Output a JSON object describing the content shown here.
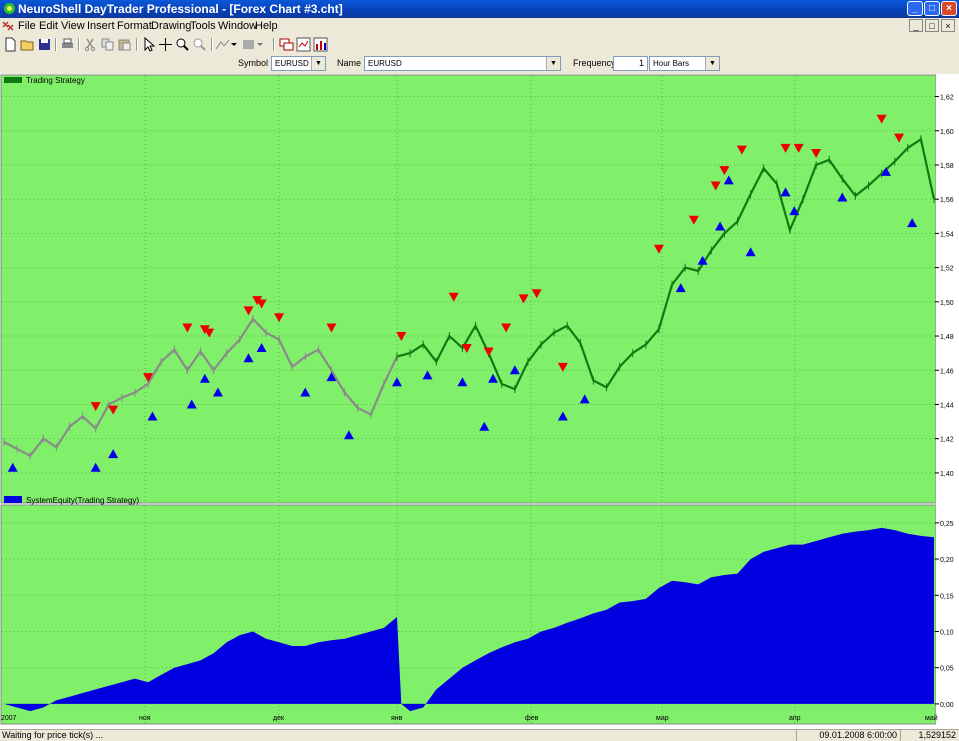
{
  "window": {
    "title": "NeuroShell DayTrader Professional - [Forex Chart #3.cht]",
    "buttons": [
      "_",
      "□",
      "×"
    ]
  },
  "menu": {
    "items": [
      "File",
      "Edit",
      "View",
      "Insert",
      "Format",
      "Drawing",
      "Tools",
      "Window",
      "Help"
    ]
  },
  "toolbar": {
    "icons": [
      "new-icon",
      "open-icon",
      "save-icon",
      "print-icon",
      "cut-icon",
      "copy-icon",
      "paste-icon",
      "pointer-icon",
      "crosshair-icon",
      "zoom-in-icon",
      "zoom-out-icon",
      "line-tool-icon",
      "color-tool-icon",
      "windows-icon",
      "indicator-icon",
      "chart-icon"
    ]
  },
  "symbol_bar": {
    "symbol_label": "Symbol",
    "symbol_value": "EURUSD",
    "name_label": "Name",
    "name_value": "EURUSD",
    "frequency_label": "Frequency",
    "frequency_value": "1",
    "frequency_unit": "Hour Bars"
  },
  "colors": {
    "chart_bg": "#80f06a",
    "equity_fill": "#0000e0",
    "sell_marker": "#ee0000",
    "buy_marker": "#0000ee",
    "price_in_position": "#107a10",
    "price_out_position": "#8a8a8a"
  },
  "status": {
    "message": "Waiting for price tick(s) ...",
    "datetime": "09.01.2008 6:00:00",
    "price": "1,529152"
  },
  "chart_data": [
    {
      "type": "line",
      "legend": "Trading Strategy",
      "yticks": [
        "1,40",
        "1,42",
        "1,44",
        "1,46",
        "1,48",
        "1,50",
        "1,52",
        "1,54",
        "1,56",
        "1,58",
        "1,60",
        "1,62"
      ],
      "ylim": [
        1.39,
        1.625
      ],
      "xticks": [
        "2007",
        "ноя",
        "дек",
        "янв",
        "фев",
        "мар",
        "апр",
        "май"
      ],
      "x": [
        0,
        3,
        6,
        9,
        12,
        15,
        18,
        21,
        24,
        27,
        30,
        33,
        36,
        39,
        42,
        45,
        48,
        51,
        54,
        57,
        60,
        63,
        66,
        69,
        72,
        75,
        78,
        81,
        84,
        87,
        90,
        93,
        96,
        99,
        102,
        105,
        108,
        111,
        114,
        117,
        120,
        123,
        126,
        129,
        132,
        135,
        138,
        141,
        144,
        147,
        150,
        153,
        156,
        159,
        162,
        165,
        168,
        171,
        174,
        177,
        180,
        183,
        186,
        189,
        192,
        195,
        198,
        201,
        204,
        207,
        210,
        213
      ],
      "close": [
        1.418,
        1.414,
        1.41,
        1.42,
        1.415,
        1.427,
        1.433,
        1.426,
        1.44,
        1.444,
        1.447,
        1.452,
        1.465,
        1.472,
        1.46,
        1.471,
        1.46,
        1.47,
        1.478,
        1.49,
        1.482,
        1.478,
        1.462,
        1.468,
        1.472,
        1.46,
        1.447,
        1.438,
        1.434,
        1.452,
        1.468,
        1.47,
        1.475,
        1.465,
        1.48,
        1.473,
        1.486,
        1.47,
        1.452,
        1.449,
        1.465,
        1.475,
        1.482,
        1.486,
        1.476,
        1.454,
        1.45,
        1.462,
        1.47,
        1.475,
        1.484,
        1.51,
        1.52,
        1.518,
        1.53,
        1.54,
        1.547,
        1.563,
        1.578,
        1.569,
        1.542,
        1.56,
        1.58,
        1.583,
        1.572,
        1.562,
        1.568,
        1.575,
        1.582,
        1.59,
        1.595,
        1.56
      ],
      "in_position_from": 90,
      "buy_signals": [
        {
          "x": 2,
          "y": 1.403
        },
        {
          "x": 21,
          "y": 1.403
        },
        {
          "x": 25,
          "y": 1.411
        },
        {
          "x": 34,
          "y": 1.433
        },
        {
          "x": 43,
          "y": 1.44
        },
        {
          "x": 46,
          "y": 1.455
        },
        {
          "x": 49,
          "y": 1.447
        },
        {
          "x": 56,
          "y": 1.467
        },
        {
          "x": 59,
          "y": 1.473
        },
        {
          "x": 69,
          "y": 1.447
        },
        {
          "x": 75,
          "y": 1.456
        },
        {
          "x": 79,
          "y": 1.422
        },
        {
          "x": 90,
          "y": 1.453
        },
        {
          "x": 97,
          "y": 1.457
        },
        {
          "x": 105,
          "y": 1.453
        },
        {
          "x": 110,
          "y": 1.427
        },
        {
          "x": 112,
          "y": 1.455
        },
        {
          "x": 117,
          "y": 1.46
        },
        {
          "x": 128,
          "y": 1.433
        },
        {
          "x": 133,
          "y": 1.443
        },
        {
          "x": 155,
          "y": 1.508
        },
        {
          "x": 160,
          "y": 1.524
        },
        {
          "x": 164,
          "y": 1.544
        },
        {
          "x": 166,
          "y": 1.571
        },
        {
          "x": 171,
          "y": 1.529
        },
        {
          "x": 179,
          "y": 1.564
        },
        {
          "x": 181,
          "y": 1.553
        },
        {
          "x": 192,
          "y": 1.561
        },
        {
          "x": 202,
          "y": 1.576
        },
        {
          "x": 208,
          "y": 1.546
        }
      ],
      "sell_signals": [
        {
          "x": 21,
          "y": 1.439
        },
        {
          "x": 25,
          "y": 1.437
        },
        {
          "x": 33,
          "y": 1.456
        },
        {
          "x": 42,
          "y": 1.485
        },
        {
          "x": 46,
          "y": 1.484
        },
        {
          "x": 47,
          "y": 1.482
        },
        {
          "x": 56,
          "y": 1.495
        },
        {
          "x": 58,
          "y": 1.501
        },
        {
          "x": 59,
          "y": 1.499
        },
        {
          "x": 63,
          "y": 1.491
        },
        {
          "x": 75,
          "y": 1.485
        },
        {
          "x": 91,
          "y": 1.48
        },
        {
          "x": 103,
          "y": 1.503
        },
        {
          "x": 106,
          "y": 1.473
        },
        {
          "x": 111,
          "y": 1.471
        },
        {
          "x": 115,
          "y": 1.485
        },
        {
          "x": 119,
          "y": 1.502
        },
        {
          "x": 122,
          "y": 1.505
        },
        {
          "x": 128,
          "y": 1.462
        },
        {
          "x": 150,
          "y": 1.531
        },
        {
          "x": 158,
          "y": 1.548
        },
        {
          "x": 163,
          "y": 1.568
        },
        {
          "x": 165,
          "y": 1.577
        },
        {
          "x": 169,
          "y": 1.589
        },
        {
          "x": 179,
          "y": 1.59
        },
        {
          "x": 182,
          "y": 1.59
        },
        {
          "x": 186,
          "y": 1.587
        },
        {
          "x": 201,
          "y": 1.607
        },
        {
          "x": 205,
          "y": 1.596
        }
      ]
    },
    {
      "type": "area",
      "legend": "SystemEquity(Trading Strategy)",
      "yticks": [
        "0,00",
        "0,05",
        "0,10",
        "0,15",
        "0,20",
        "0,25"
      ],
      "ylim": [
        -0.025,
        0.265
      ],
      "xticks": [
        "2007",
        "ноя",
        "дек",
        "янв",
        "фев",
        "мар",
        "апр",
        "май"
      ],
      "x": [
        0,
        3,
        6,
        9,
        12,
        15,
        18,
        21,
        24,
        27,
        30,
        33,
        36,
        39,
        42,
        45,
        48,
        51,
        54,
        57,
        60,
        63,
        66,
        69,
        72,
        75,
        78,
        81,
        84,
        87,
        90,
        91,
        93,
        96,
        99,
        102,
        105,
        108,
        111,
        114,
        117,
        120,
        123,
        126,
        129,
        132,
        135,
        138,
        141,
        144,
        147,
        150,
        153,
        156,
        159,
        162,
        165,
        168,
        171,
        174,
        177,
        180,
        183,
        186,
        189,
        192,
        195,
        198,
        201,
        204,
        207,
        210,
        213
      ],
      "values": [
        0.0,
        -0.005,
        -0.01,
        -0.005,
        0.005,
        0.01,
        0.015,
        0.02,
        0.025,
        0.03,
        0.035,
        0.03,
        0.04,
        0.05,
        0.055,
        0.06,
        0.07,
        0.085,
        0.095,
        0.1,
        0.09,
        0.085,
        0.08,
        0.08,
        0.085,
        0.088,
        0.09,
        0.095,
        0.1,
        0.105,
        0.12,
        0.0,
        -0.01,
        -0.005,
        0.02,
        0.035,
        0.05,
        0.06,
        0.07,
        0.078,
        0.085,
        0.09,
        0.1,
        0.105,
        0.112,
        0.118,
        0.125,
        0.13,
        0.14,
        0.142,
        0.145,
        0.16,
        0.17,
        0.168,
        0.165,
        0.175,
        0.178,
        0.18,
        0.2,
        0.21,
        0.215,
        0.22,
        0.22,
        0.225,
        0.23,
        0.235,
        0.238,
        0.24,
        0.243,
        0.24,
        0.235,
        0.232,
        0.23
      ]
    }
  ]
}
